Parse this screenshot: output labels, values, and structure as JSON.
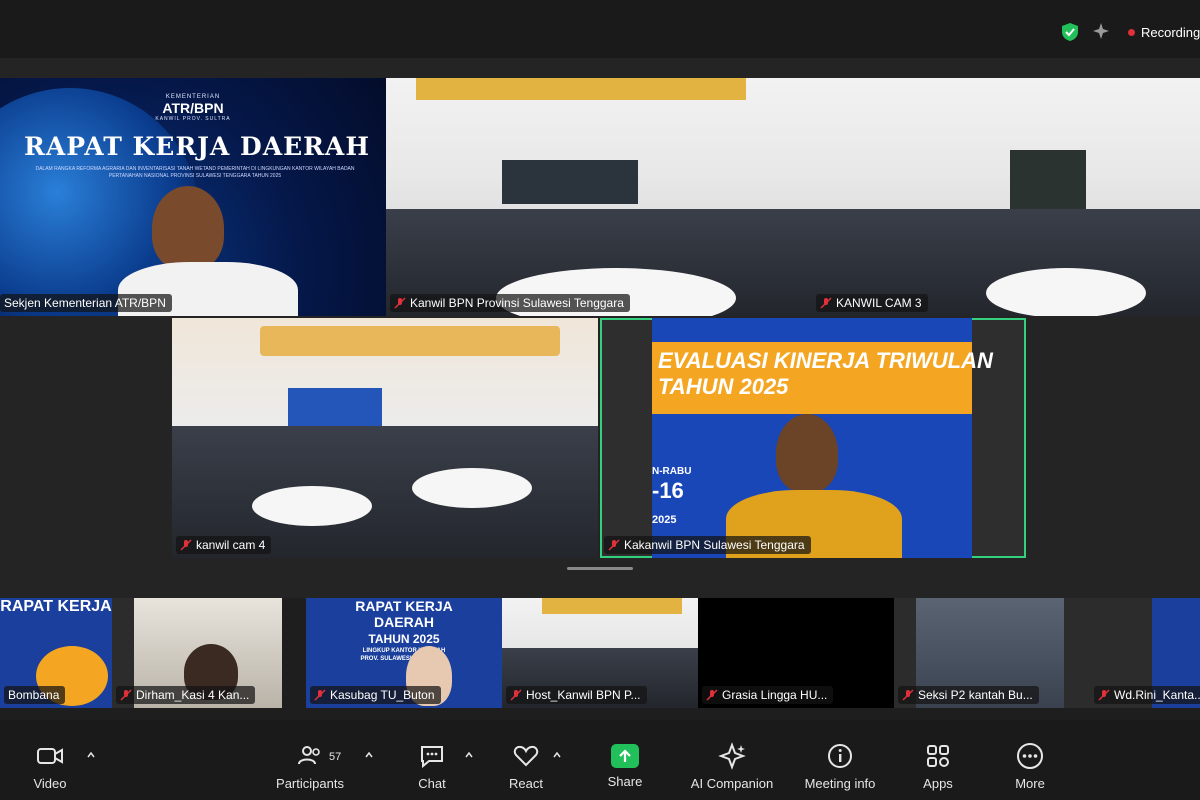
{
  "status": {
    "recording": "Recording"
  },
  "main_tiles": [
    {
      "name": "Sekjen Kementerian ATR/BPN",
      "muted": false
    },
    {
      "name": "Kanwil BPN Provinsi Sulawesi Tenggara",
      "muted": true
    },
    {
      "name": "KANWIL CAM 3",
      "muted": true
    },
    {
      "name": "kanwil cam 4",
      "muted": true
    },
    {
      "name": "Kakanwil BPN Sulawesi Tenggara",
      "muted": true
    }
  ],
  "banner": {
    "kementerian": "KEMENTERIAN",
    "brand": "ATR/BPN",
    "province": "KANWIL PROV. SULTRA",
    "title": "RAPAT KERJA DAERAH",
    "subtitle": "DALAM RANGKA REFORMA AGRARIA DAN INVENTARISASI TANAH WETAND PEMERINTAH DI LINGKUNGAN KANTOR WILAYAH BADAN PERTANAHAN NASIONAL PROVINSI SULAWESI TENGGARA TAHUN 2025"
  },
  "stage_screen": {
    "title_line1": "EVALUASI KINERJA TRIWULAN",
    "title_line2": "TAHUN 2025",
    "side_day": "N-RABU",
    "side_date": "-16",
    "side_year": "2025"
  },
  "strip_tiles": [
    {
      "name": "Bombana"
    },
    {
      "name": "Dirham_Kasi 4 Kan..."
    },
    {
      "name": "Kasubag TU_Buton"
    },
    {
      "name": "Host_Kanwil BPN P..."
    },
    {
      "name": "Grasia Lingga HU..."
    },
    {
      "name": "Seksi P2 kantah Bu..."
    },
    {
      "name": "Wd.Rini_Kanta..."
    }
  ],
  "strip_poster": {
    "line1": "RAPAT KERJA",
    "line2": "DAERAH",
    "line3": "TAHUN 2025",
    "line4": "LINGKUP KANTOR WILAYAH",
    "line5": "PROV. SULAWESI TENGGARA"
  },
  "toolbar": {
    "video": "Video",
    "participants": "Participants",
    "participants_count": "57",
    "chat": "Chat",
    "react": "React",
    "share": "Share",
    "ai_companion": "AI Companion",
    "meeting_info": "Meeting info",
    "apps": "Apps",
    "more": "More"
  },
  "colors": {
    "accent_active": "#35d07f",
    "share_green": "#22c05a",
    "recording_red": "#e0303a",
    "banner_blue": "#1947b8",
    "banner_orange": "#f4a623"
  }
}
